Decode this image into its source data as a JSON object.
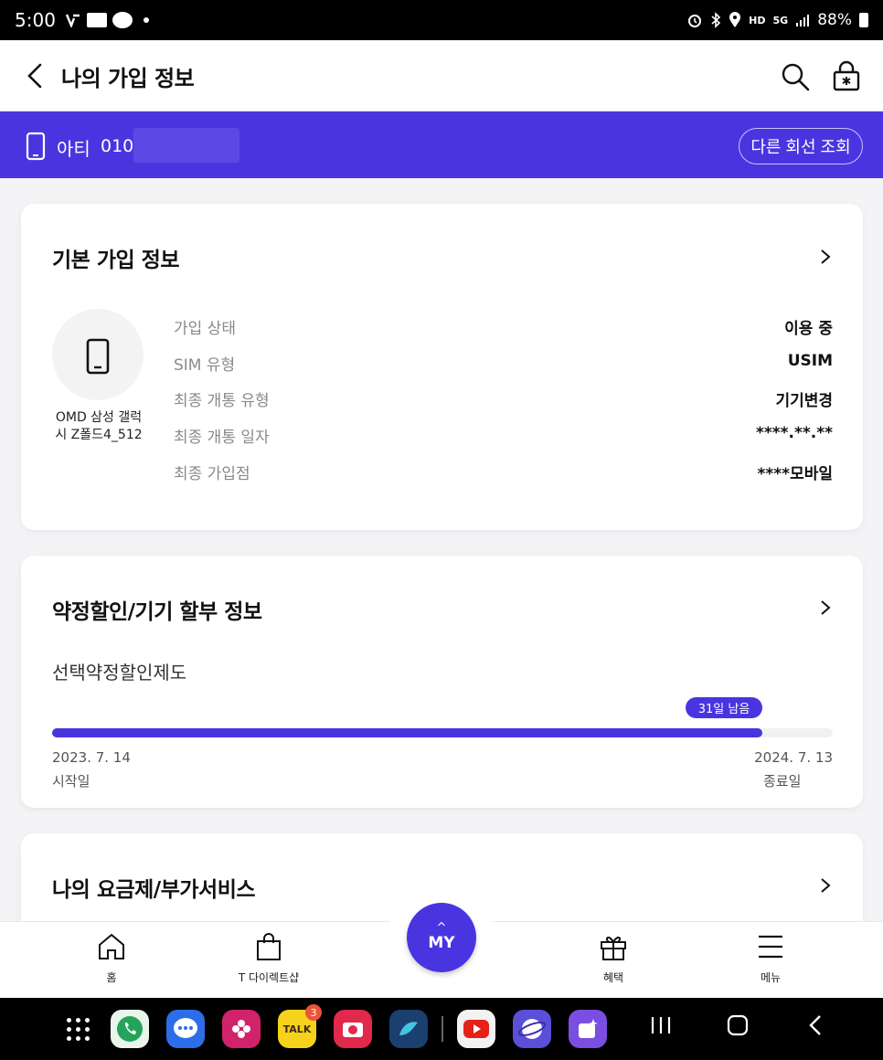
{
  "status_bar": {
    "time": "5:00",
    "battery": "88%",
    "hd_label": "HD",
    "network_label": "5G"
  },
  "header": {
    "title": "나의 가입 정보"
  },
  "line_bar": {
    "name": "아티",
    "number_prefix": "010",
    "other_line_button": "다른 회선 조회"
  },
  "basic_info": {
    "title": "기본 가입 정보",
    "device_name_line1": "OMD 삼성 갤럭",
    "device_name_line2": "시 Z폴드4_512",
    "rows": [
      {
        "label": "가입 상태",
        "value": "이용 중"
      },
      {
        "label": "SIM 유형",
        "value": "USIM"
      },
      {
        "label": "최종 개통 유형",
        "value": "기기변경"
      },
      {
        "label": "최종 개통 일자",
        "value": "****.**.**"
      },
      {
        "label": "최종 가입점",
        "value": "****모바일"
      }
    ]
  },
  "contract": {
    "title": "약정할인/기기 할부 정보",
    "plan_name": "선택약정할인제도",
    "remaining_badge": "31일 남음",
    "progress": 0.91,
    "start_date": "2023. 7. 14",
    "start_label": "시작일",
    "end_date": "2024. 7. 13",
    "end_label": "종료일"
  },
  "plans": {
    "title": "나의 요금제/부가서비스"
  },
  "bottom_nav": {
    "home": "홈",
    "tdirect": "T 다이렉트샵",
    "my": "MY",
    "benefits": "혜택",
    "menu": "메뉴"
  },
  "dock": {
    "kakaotalk_label": "TALK",
    "kakaotalk_badge": "3"
  },
  "colors": {
    "accent": "#4935e0"
  }
}
